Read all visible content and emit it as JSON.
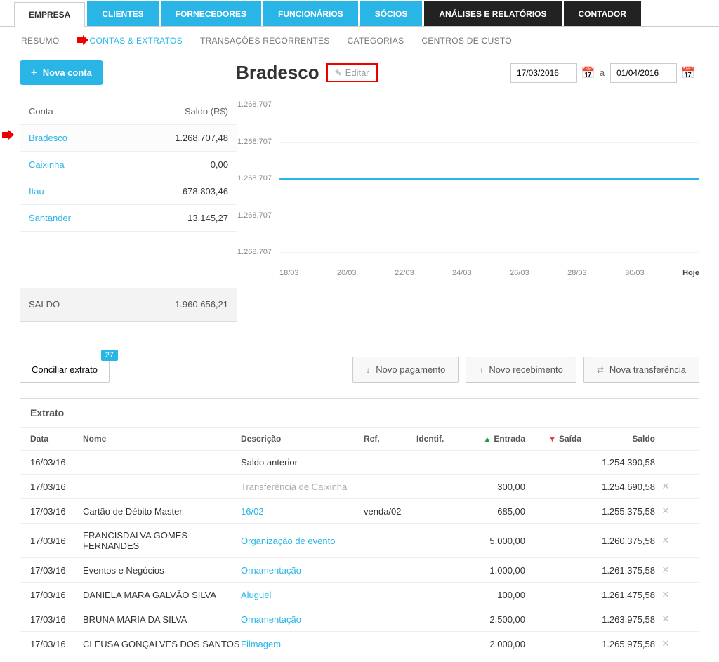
{
  "tabs": {
    "primary": [
      "EMPRESA",
      "CLIENTES",
      "FORNECEDORES",
      "FUNCIONÁRIOS",
      "SÓCIOS",
      "ANÁLISES E RELATÓRIOS",
      "CONTADOR"
    ],
    "sub": [
      "RESUMO",
      "CONTAS & EXTRATOS",
      "TRANSAÇÕES RECORRENTES",
      "CATEGORIAS",
      "CENTROS DE CUSTO"
    ]
  },
  "buttons": {
    "new_account": "Nova conta",
    "edit": "Editar",
    "reconcile": "Conciliar extrato",
    "reconcile_badge": "27",
    "new_payment": "Novo pagamento",
    "new_receipt": "Novo recebimento",
    "new_transfer": "Nova transferência"
  },
  "account_title": "Bradesco",
  "date_range": {
    "from": "17/03/2016",
    "to": "01/04/2016",
    "sep": "a"
  },
  "accounts": {
    "col_name": "Conta",
    "col_balance": "Saldo (R$)",
    "rows": [
      {
        "name": "Bradesco",
        "balance": "1.268.707,48"
      },
      {
        "name": "Caixinha",
        "balance": "0,00"
      },
      {
        "name": "Itau",
        "balance": "678.803,46"
      },
      {
        "name": "Santander",
        "balance": "13.145,27"
      }
    ],
    "total_label": "SALDO",
    "total": "1.960.656,21"
  },
  "chart_data": {
    "type": "line",
    "title": "",
    "xlabel": "",
    "ylabel": "",
    "ylim": [
      1268707,
      1268707
    ],
    "y_ticks": [
      "1.268.707",
      "1.268.707",
      "1.268.707",
      "1.268.707",
      "1.268.707"
    ],
    "x_ticks": [
      "18/03",
      "20/03",
      "22/03",
      "24/03",
      "26/03",
      "28/03",
      "30/03",
      "Hoje"
    ],
    "series": [
      {
        "name": "Saldo",
        "values": [
          1268707,
          1268707,
          1268707,
          1268707,
          1268707,
          1268707,
          1268707,
          1268707
        ]
      }
    ]
  },
  "statement": {
    "title": "Extrato",
    "cols": {
      "data": "Data",
      "nome": "Nome",
      "desc": "Descrição",
      "ref": "Ref.",
      "ident": "Identif.",
      "ent": "Entrada",
      "sai": "Saída",
      "saldo": "Saldo"
    },
    "rows": [
      {
        "data": "16/03/16",
        "nome": "",
        "desc": "Saldo anterior",
        "desc_link": false,
        "ref": "",
        "ident": "",
        "ent": "",
        "sai": "",
        "saldo": "1.254.390,58",
        "del": false
      },
      {
        "data": "17/03/16",
        "nome": "",
        "desc": "Transferência de Caixinha",
        "desc_link": false,
        "desc_muted": true,
        "ref": "",
        "ident": "",
        "ent": "300,00",
        "sai": "",
        "saldo": "1.254.690,58",
        "del": true
      },
      {
        "data": "17/03/16",
        "nome": "Cartão de Débito Master",
        "desc": "16/02",
        "desc_link": true,
        "ref": "venda/02",
        "ident": "",
        "ent": "685,00",
        "sai": "",
        "saldo": "1.255.375,58",
        "del": true
      },
      {
        "data": "17/03/16",
        "nome": "FRANCISDALVA GOMES FERNANDES",
        "desc": "Organização de evento",
        "desc_link": true,
        "ref": "",
        "ident": "",
        "ent": "5.000,00",
        "sai": "",
        "saldo": "1.260.375,58",
        "del": true
      },
      {
        "data": "17/03/16",
        "nome": "Eventos e Negócios",
        "desc": "Ornamentação",
        "desc_link": true,
        "ref": "",
        "ident": "",
        "ent": "1.000,00",
        "sai": "",
        "saldo": "1.261.375,58",
        "del": true
      },
      {
        "data": "17/03/16",
        "nome": "DANIELA MARA GALVÃO SILVA",
        "desc": "Aluguel",
        "desc_link": true,
        "ref": "",
        "ident": "",
        "ent": "100,00",
        "sai": "",
        "saldo": "1.261.475,58",
        "del": true
      },
      {
        "data": "17/03/16",
        "nome": "BRUNA MARIA DA SILVA",
        "desc": "Ornamentação",
        "desc_link": true,
        "ref": "",
        "ident": "",
        "ent": "2.500,00",
        "sai": "",
        "saldo": "1.263.975,58",
        "del": true
      },
      {
        "data": "17/03/16",
        "nome": "CLEUSA GONÇALVES DOS SANTOS",
        "desc": "Filmagem",
        "desc_link": true,
        "ref": "",
        "ident": "",
        "ent": "2.000,00",
        "sai": "",
        "saldo": "1.265.975,58",
        "del": true
      }
    ]
  }
}
